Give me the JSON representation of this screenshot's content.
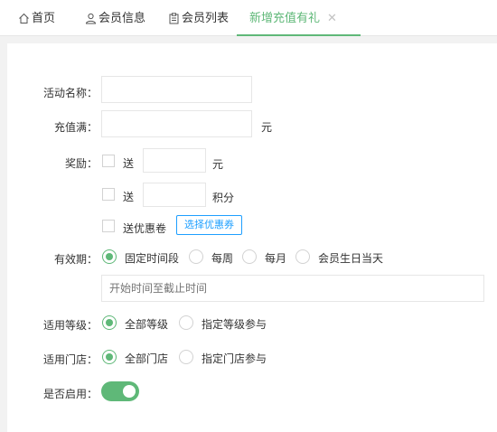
{
  "tabs": [
    {
      "label": "首页",
      "icon": "home-icon",
      "active": false
    },
    {
      "label": "会员信息",
      "icon": "user-icon",
      "active": false
    },
    {
      "label": "会员列表",
      "icon": "clipboard-icon",
      "active": false
    },
    {
      "label": "新增充值有礼",
      "active": true,
      "close": "✕"
    }
  ],
  "form": {
    "activity_name": {
      "label": "活动名称：",
      "value": ""
    },
    "recharge": {
      "label": "充值满：",
      "value": "",
      "unit": "元"
    },
    "reward": {
      "label": "奖励：",
      "cash": {
        "text": "送",
        "value": "",
        "unit": "元",
        "checked": false
      },
      "points": {
        "text": "送",
        "value": "",
        "unit": "积分",
        "checked": false
      },
      "coupon": {
        "text": "送优惠卷",
        "button": "选择优惠券",
        "checked": false
      }
    },
    "validity": {
      "label": "有效期：",
      "options": [
        "固定时间段",
        "每周",
        "每月",
        "会员生日当天"
      ],
      "selected": "固定时间段",
      "range_placeholder": "开始时间至截止时间"
    },
    "level": {
      "label": "适用等级：",
      "options": [
        "全部等级",
        "指定等级参与"
      ],
      "selected": "全部等级"
    },
    "store": {
      "label": "适用门店：",
      "options": [
        "全部门店",
        "指定门店参与"
      ],
      "selected": "全部门店"
    },
    "enable": {
      "label": "是否启用：",
      "on": true
    }
  },
  "colors": {
    "accent": "#5fb878",
    "button_blue": "#1e9fff"
  }
}
